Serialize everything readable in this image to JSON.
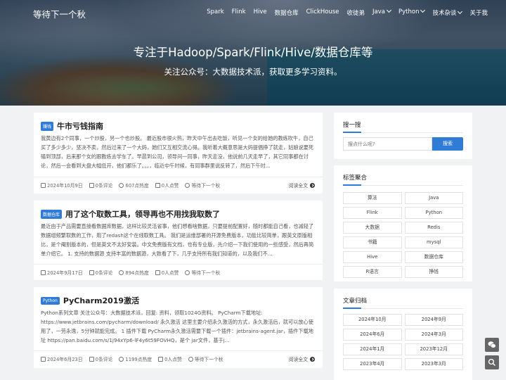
{
  "site": {
    "brand": "等待下一个秋"
  },
  "nav": {
    "items": [
      {
        "label": "Spark",
        "dropdown": false
      },
      {
        "label": "Flink",
        "dropdown": false
      },
      {
        "label": "Hive",
        "dropdown": false
      },
      {
        "label": "数据仓库",
        "dropdown": false
      },
      {
        "label": "ClickHouse",
        "dropdown": false
      },
      {
        "label": "收徒弟",
        "dropdown": false
      },
      {
        "label": "Java",
        "dropdown": true
      },
      {
        "label": "Python",
        "dropdown": true
      },
      {
        "label": "技术杂谈",
        "dropdown": true
      },
      {
        "label": "关于我",
        "dropdown": false
      }
    ]
  },
  "hero": {
    "title": "专注于Hadoop/Spark/Flink/Hive/数据仓库等",
    "subtitle": "关注公众号：大数据技术派，获取更多学习资料。"
  },
  "posts": [
    {
      "badge": "赚钱",
      "title": "牛市亏钱指南",
      "excerpt": "我黄边有2个同事，一个炒股，另一个也炒股。 最近股市很火热，昨天中午出去吃饭，听见一个女的给她的教练吹牛，自己买了多少多少，坚决不卖，然后过来了一个大妈，她们又互相交流心得。我听着大概意思是大妈提倡挣了就走，姑娘说要死磕到顶部，后来那个女的跟教练去学车了。早晨到公司，领导问一同事，昨天走没，他说前几天走早了，其它同事都在讨论，然后一会看到大盘大幅低开，他们都乐了。。。，临近中午时候，有同事群里说反转了，然后下午时...",
      "date": "2024年10月9日",
      "comments": "0条评论",
      "views": "607点热度",
      "likes": "0人点赞",
      "author": "等待下一个秋",
      "read_more": "阅读全文"
    },
    {
      "badge": "数据仓库",
      "title": "用了这个取数工具，领导再也不用找我取数了",
      "excerpt": "最近由于产品需要直接看数据库数据，这样比较灵活省事，他们想看啥数据，只要提前配置好，随时都能自己看，也减轻了数据组频繁取数的工作，用了redash这个在线取数工具。 我们是运维部署的开源免费版本，功能比较简单，跟英文原版相比，是个阉割版本的，但是英文不太好安装。中文免费版有文档，也有专业版，先介绍一下我们使用的一些感受，然后再简单介绍它。 1. 支持的数据源 支持丰富的数据源，大致看了下，几乎支持所有我们知道的，以及我们不...",
      "date": "2024年9月17日",
      "comments": "0条评论",
      "views": "894点热度",
      "likes": "0人点赞",
      "author": "等待下一个秋",
      "read_more": "阅读全文"
    },
    {
      "badge": "Python",
      "title": "PyCharm2019激活",
      "excerpt": "Python系列文章 关注公众号：大数据技术派，回复: 资料，领取1024G资料。 PyCharm下载地址: https://www.jetbrains.com/pycharm/download/ 永久激活 这里主要介绍永久激活的方式，永久激活后，就可以放心使用了，一劳永逸，5分钟就能完成。 1 插件下载 PyCharm永久激活需要下载一个插件：jetbrains-agent.jar，插件下载地址 https://pan.baidu.com/s/1j94xYp6-lF4y6t59FOVHQ，是个 jar文件，基于j...",
      "date": "2024年6月23日",
      "comments": "0条评论",
      "views": "1199点热度",
      "likes": "0人点赞",
      "author": "等待下一个秋",
      "read_more": "阅读全文"
    }
  ],
  "sidebar": {
    "search": {
      "title": "搜一搜",
      "placeholder": "搜点什么呢?",
      "button": "搜索"
    },
    "tags": {
      "title": "标签聚合",
      "items": [
        "算法",
        "Java",
        "Flink",
        "Python",
        "大数据",
        "Redis",
        "书籍",
        "mysql",
        "Hive",
        "数据仓库",
        "R语言",
        "挣钱"
      ]
    },
    "archive": {
      "title": "文章归档",
      "items": [
        "2024年10月",
        "2024年9月",
        "2024年6月",
        "2024年3月",
        "2024年1月",
        "2023年12月",
        "2023年4月",
        "2023年3月"
      ]
    }
  },
  "floating": [
    "wechat-icon",
    "search-icon"
  ],
  "colors": {
    "accent": "#2f7bd6",
    "background": "#f1f2f4"
  }
}
